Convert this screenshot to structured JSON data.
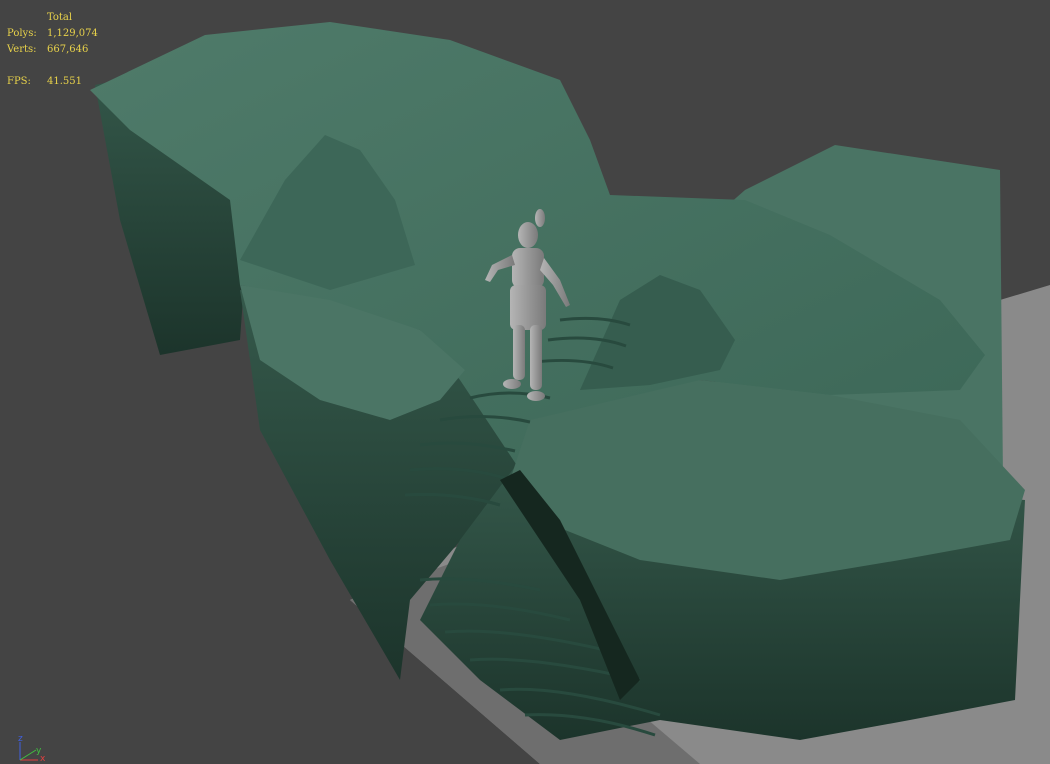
{
  "viewport": {
    "colors": {
      "background": "#444444",
      "ground_plane": "#8a8a8a",
      "rock": "#3f6a5a",
      "rock_dark": "#1f3a31",
      "character": "#9a9a9a",
      "stats_text": "#e8d24a"
    }
  },
  "stats": {
    "title": "Total",
    "polys_label": "Polys:",
    "polys_value": "1,129,074",
    "verts_label": "Verts:",
    "verts_value": "667,646",
    "fps_label": "FPS:",
    "fps_value": "41.551"
  },
  "axis_tripod": {
    "z": "z",
    "x": "x",
    "y": "y",
    "colors": {
      "x": "#e04040",
      "y": "#40c040",
      "z": "#4060e0"
    }
  }
}
